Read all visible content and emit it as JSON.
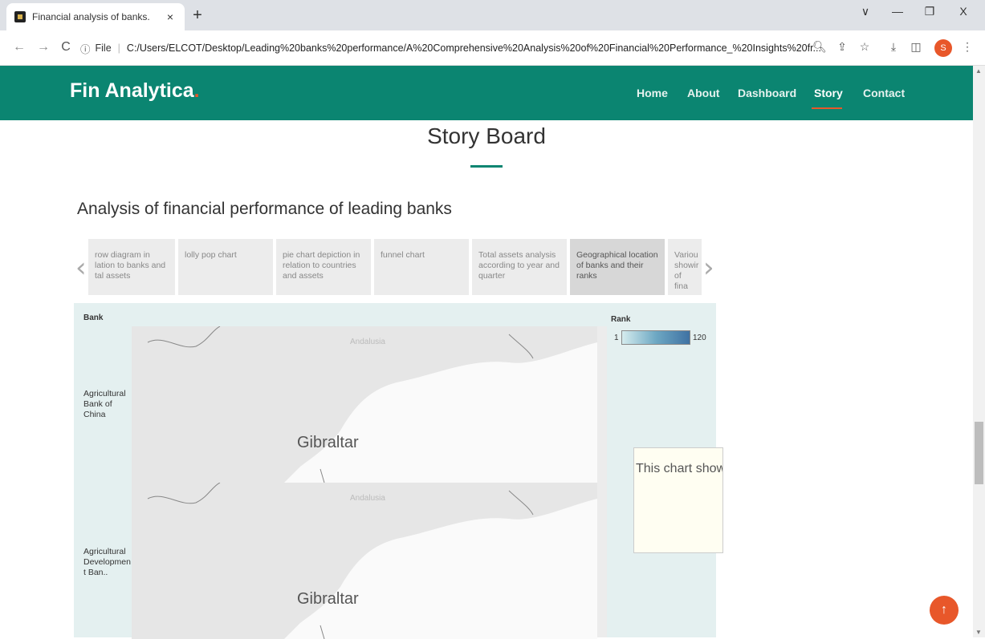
{
  "browser": {
    "tab_title": "Financial analysis of banks.",
    "tab_close": "×",
    "new_tab": "+",
    "win_min": "—",
    "win_restore": "❐",
    "win_close": "X",
    "win_chevron": "∨",
    "back": "←",
    "forward": "→",
    "reload": "C",
    "info_icon": "ⓘ",
    "file_label": "File",
    "url": "C:/Users/ELCOT/Desktop/Leading%20banks%20performance/A%20Comprehensive%20Analysis%20of%20Financial%20Performance_%20Insights%20fr...",
    "profile_initial": "S"
  },
  "site": {
    "brand": "Fin Analytica",
    "brand_dot": ".",
    "nav": [
      "Home",
      "About",
      "Dashboard",
      "Story",
      "Contact"
    ],
    "active_nav": "Story"
  },
  "page": {
    "title": "Story Board",
    "section_title": "Analysis of financial performance of leading banks"
  },
  "story": {
    "prev_arrow": "‹",
    "next_arrow": "›",
    "tabs": [
      "row diagram in lation to banks and tal assets",
      "lolly pop chart",
      "pie chart depiction in relation to countries and assets",
      "funnel chart",
      "Total assets analysis according to year and quarter",
      "Geographical location of banks and their ranks",
      "Variou showir of fina"
    ],
    "active_index": 5
  },
  "viz": {
    "bank_header": "Bank",
    "rank_header": "Rank",
    "legend_min": "1",
    "legend_max": "120",
    "rows": [
      {
        "bank": "Agricultural Bank of China",
        "region": "Andalusia",
        "city": "Gibraltar"
      },
      {
        "bank": "Agricultural Developmen t Ban..",
        "region": "Andalusia",
        "city": "Gibraltar"
      }
    ],
    "tooltip": "This chart show geographical lo of banks and th rank position"
  },
  "colors": {
    "brand": "#0b8571",
    "accent": "#e8572a"
  },
  "back_to_top": "↑"
}
